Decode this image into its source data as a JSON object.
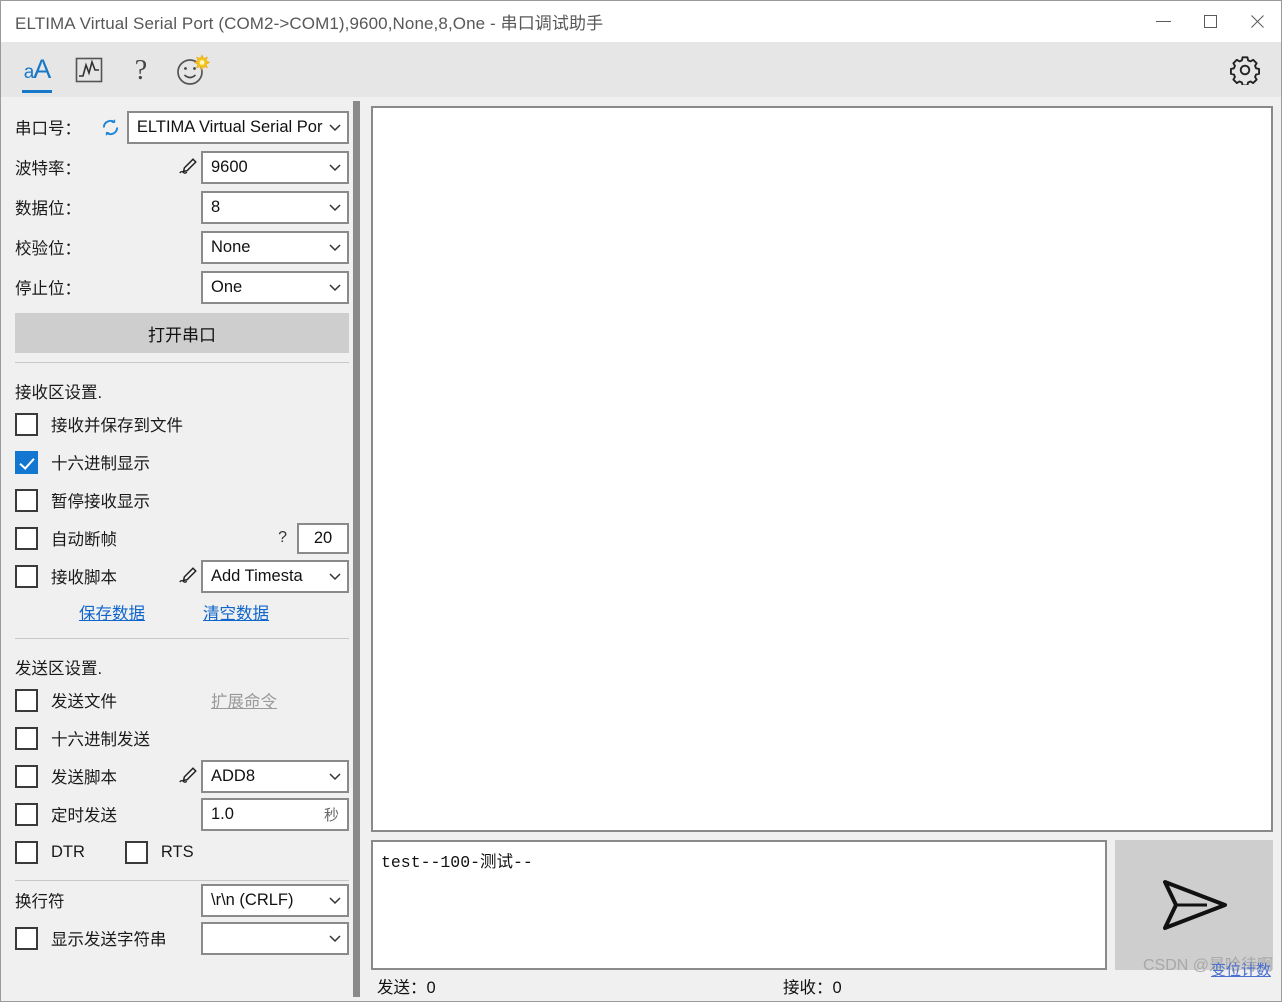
{
  "window": {
    "title": "ELTIMA Virtual Serial Port (COM2->COM1),9600,None,8,One - 串口调试助手",
    "minimize_label": "最小化",
    "maximize_label": "最大化",
    "close_label": "关闭"
  },
  "toolbar": {
    "font_icon": "font-size-icon",
    "font_icon_text_small": "a",
    "font_icon_text_large": "A",
    "chart_icon": "waveform-chart-icon",
    "help_icon": "question-mark-icon",
    "smiley_icon": "smiley-sun-icon",
    "settings_icon": "gear-icon"
  },
  "sidebar": {
    "serial": {
      "port_label": "串口号：",
      "port_value": "ELTIMA Virtual Serial Por",
      "refresh_icon": "refresh-icon",
      "baud_label": "波特率：",
      "baud_value": "9600",
      "databits_label": "数据位：",
      "databits_value": "8",
      "parity_label": "校验位：",
      "parity_value": "None",
      "stopbits_label": "停止位：",
      "stopbits_value": "One",
      "open_button": "打开串口",
      "pen_icon": "pen-script-icon"
    },
    "receive": {
      "section_title": "接收区设置.",
      "save_to_file_label": "接收并保存到文件",
      "save_to_file_checked": false,
      "hex_display_label": "十六进制显示",
      "hex_display_checked": true,
      "pause_display_label": "暂停接收显示",
      "pause_display_checked": false,
      "auto_break_label": "自动断帧",
      "auto_break_checked": false,
      "auto_break_hint": "?",
      "auto_break_value": "20",
      "recv_script_label": "接收脚本",
      "recv_script_checked": false,
      "recv_script_value": "Add Timesta",
      "save_data_link": "保存数据",
      "clear_data_link": "清空数据"
    },
    "send": {
      "section_title": "发送区设置.",
      "send_file_label": "发送文件",
      "send_file_checked": false,
      "extend_cmd_link": "扩展命令",
      "hex_send_label": "十六进制发送",
      "hex_send_checked": false,
      "send_script_label": "发送脚本",
      "send_script_checked": false,
      "send_script_value": "ADD8",
      "timed_send_label": "定时发送",
      "timed_send_checked": false,
      "timed_send_value": "1.0",
      "timed_send_unit": "秒",
      "dtr_label": "DTR",
      "dtr_checked": false,
      "rts_label": "RTS",
      "rts_checked": false
    },
    "misc": {
      "newline_label": "换行符",
      "newline_value": "\\r\\n (CRLF)",
      "show_sent_label": "显示发送字符串",
      "show_sent_checked": false,
      "color_swatch": "#f8d8c0"
    }
  },
  "main": {
    "receive_area_text": "",
    "send_area_text": "test--100-测试--",
    "send_button_icon": "paper-plane-send-icon",
    "status_sent": "发送：0",
    "status_received": "接收：0",
    "watermark": "CSDN @是哈待啊",
    "watermark_overlay": "变位计数"
  },
  "colors": {
    "accent": "#1177d1",
    "link": "#1166cc",
    "toolbar_bg": "#e6e6e6",
    "panel_bg": "#f0f0f0",
    "button_bg": "#cecece",
    "border": "#8a8a8a"
  }
}
